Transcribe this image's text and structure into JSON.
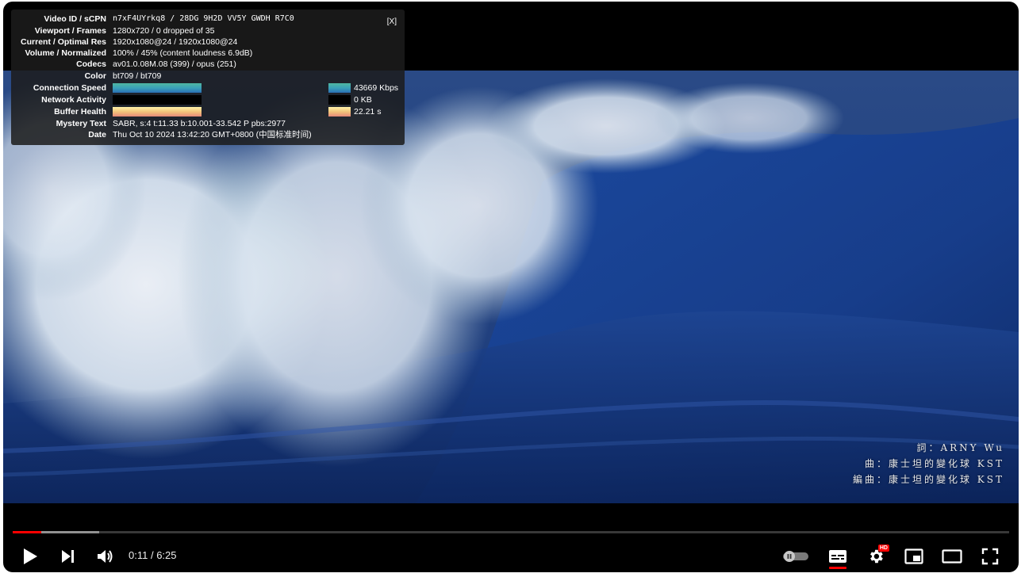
{
  "stats": {
    "close_label": "[X]",
    "rows": [
      {
        "label": "Video ID / sCPN",
        "value": "n7xF4UYrkq8  /  28DG 9H2D VV5Y GWDH R7C0"
      },
      {
        "label": "Viewport / Frames",
        "value": "1280x720 / 0 dropped of 35"
      },
      {
        "label": "Current / Optimal Res",
        "value": "1920x1080@24 / 1920x1080@24"
      },
      {
        "label": "Volume / Normalized",
        "value": "100% / 45% (content loudness 6.9dB)"
      },
      {
        "label": "Codecs",
        "value": "av01.0.08M.08 (399) / opus (251)"
      },
      {
        "label": "Color",
        "value": "bt709 / bt709"
      }
    ],
    "connection": {
      "label": "Connection Speed",
      "value": "43669 Kbps"
    },
    "network": {
      "label": "Network Activity",
      "value": "0 KB"
    },
    "buffer": {
      "label": "Buffer Health",
      "value": "22.21 s"
    },
    "mystery": {
      "label": "Mystery Text",
      "value": "SABR, s:4 t:11.33 b:10.001-33.542 P pbs:2977"
    },
    "date": {
      "label": "Date",
      "value": "Thu Oct 10 2024 13:42:20 GMT+0800 (中国标准时间)"
    },
    "colors": {
      "connection": "#3aa1b8",
      "buffer": "#f2c47a",
      "network": "#000000"
    }
  },
  "credits": {
    "line1": "詞：ARNY Wu",
    "line2": "曲：康士坦的變化球  KST",
    "line3": "編曲：康士坦的變化球  KST"
  },
  "controls": {
    "current_time": "0:11",
    "separator": " / ",
    "duration": "6:25",
    "progress_played": 0.029,
    "progress_buffered": 0.087,
    "hd_label": "HD",
    "accent": "#ff0000"
  }
}
